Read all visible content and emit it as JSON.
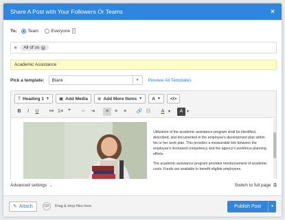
{
  "modal": {
    "title": "Share A Post with Your Followers Or Teams",
    "close": "×"
  },
  "to": {
    "label": "To:",
    "options": [
      {
        "label": "Team",
        "selected": true
      },
      {
        "label": "Everyone",
        "selected": false
      }
    ],
    "info_badge": "i"
  },
  "audience": {
    "tag": "All of us",
    "tag_remove": "×"
  },
  "subject": {
    "value": "Academic Assistance"
  },
  "template": {
    "label": "Pick a template:",
    "selected": "Blank",
    "preview_link": "Preview All Templates"
  },
  "toolbar": {
    "heading": "Heading 1",
    "add_media": "Add Media",
    "add_more": "Add More Items",
    "font_style": "A",
    "code": "</>",
    "format_buttons": [
      "B",
      "I",
      "U",
      "•≡",
      "1≡",
      "❞",
      "⇤",
      "⇥",
      "≡",
      "≡",
      "≡",
      "🔗",
      "⛓",
      "A",
      "A"
    ]
  },
  "content": {
    "paragraph1": "Utilization of the academic assistance program shall be identified, described, and documented in the employee's development plan within his or her work plan. This provides a measurable link between the employee's increased competency and the agency's workforce planning efforts.",
    "paragraph2": "The academic assistance program provides reimbursement of academic costs. Funds are available to benefit eligible employees."
  },
  "links": {
    "advanced": "Advanced settings",
    "full_page": "Switch to full page"
  },
  "footer": {
    "attach": "Attach",
    "or": "OR",
    "drop": "Drag & drop files here",
    "publish": "Publish Post"
  },
  "colors": {
    "accent": "#2e86de",
    "subject_bg": "#fdfdc8"
  }
}
